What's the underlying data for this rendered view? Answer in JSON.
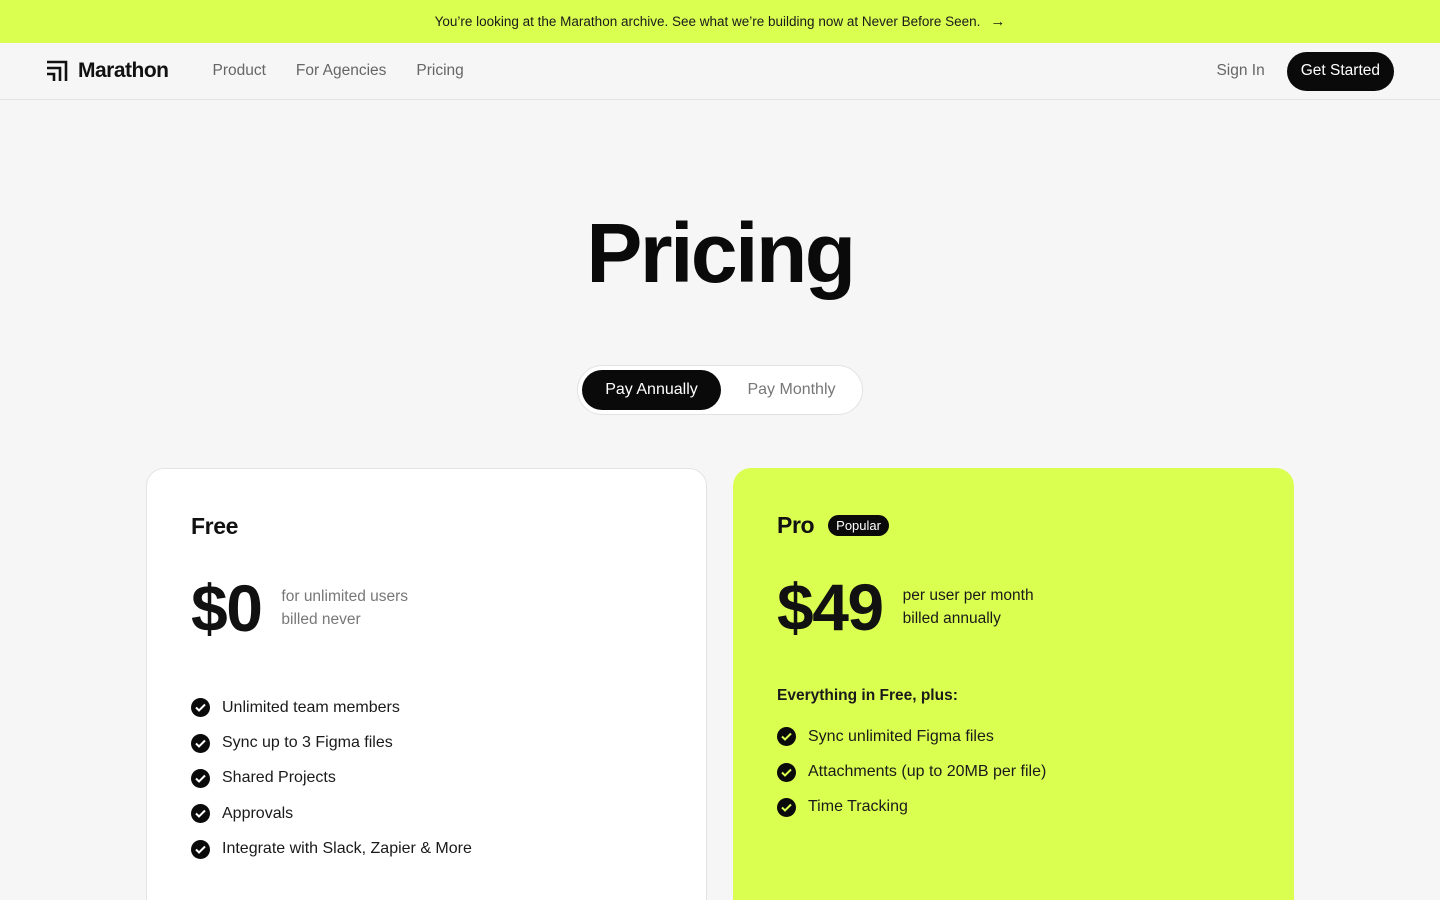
{
  "banner": {
    "text": "You’re looking at the Marathon archive. See what we’re building now at Never Before Seen.",
    "arrow_icon": "arrow-right-icon"
  },
  "nav": {
    "logo_text": "Marathon",
    "links": [
      "Product",
      "For Agencies",
      "Pricing"
    ],
    "sign_in": "Sign In",
    "cta": "Get Started"
  },
  "hero": {
    "title": "Pricing"
  },
  "billing_toggle": {
    "options": [
      "Pay Annually",
      "Pay Monthly"
    ],
    "selected": "Pay Annually"
  },
  "plans": [
    {
      "name": "Free",
      "price": "$0",
      "note_line1": "for unlimited users",
      "note_line2": "billed never",
      "features": [
        "Unlimited team members",
        "Sync up to 3 Figma files",
        "Shared Projects",
        "Approvals",
        "Integrate with Slack, Zapier & More"
      ]
    },
    {
      "name": "Pro",
      "badge": "Popular",
      "price": "$49",
      "note_line1": "per user per month",
      "note_line2": "billed annually",
      "intro": "Everything in Free, plus:",
      "features": [
        "Sync unlimited Figma files",
        "Attachments (up to 20MB per file)",
        "Time Tracking"
      ]
    }
  ],
  "colors": {
    "accent": "#dbff50",
    "dark": "#0a0a0a",
    "background": "#f6f6f6"
  }
}
